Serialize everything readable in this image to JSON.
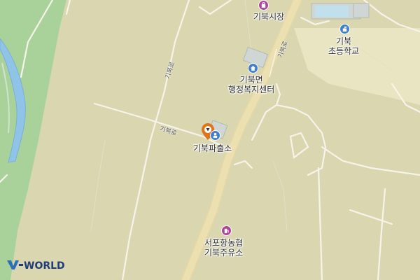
{
  "map": {
    "pois": [
      {
        "id": "market",
        "icon": "shopping-bag-icon",
        "color": "#b0449b",
        "label_lines": [
          "기북시장"
        ]
      },
      {
        "id": "school",
        "icon": "school-icon",
        "color": "#3f7fd0",
        "label_lines": [
          "기북",
          "초등학교"
        ]
      },
      {
        "id": "welfare",
        "icon": "public-office-icon",
        "color": "#3f7fd0",
        "label_lines": [
          "기북면",
          "행정복지센터"
        ]
      },
      {
        "id": "police",
        "icon": "police-icon",
        "color": "#3f7fd0",
        "label_lines": [
          "기북파출소"
        ]
      },
      {
        "id": "gas",
        "icon": "gas-station-icon",
        "color": "#b0449b",
        "label_lines": [
          "서포항농협",
          "기북주유소"
        ]
      }
    ],
    "road_labels": [
      "기북로",
      "기북로",
      "기북로"
    ],
    "marker": {
      "icon": "location-pin-icon",
      "color": "#e0741a"
    },
    "colors": {
      "land": "#d9d6b0",
      "field": "#e9e5c2",
      "river": "#8fc4e8",
      "forest": "#a8d29a",
      "road": "#f6f4ea",
      "main_road": "#ecdfb0"
    }
  },
  "branding": {
    "logo_text": "V-WORLD",
    "logo_icon": "vworld-logo-icon"
  }
}
